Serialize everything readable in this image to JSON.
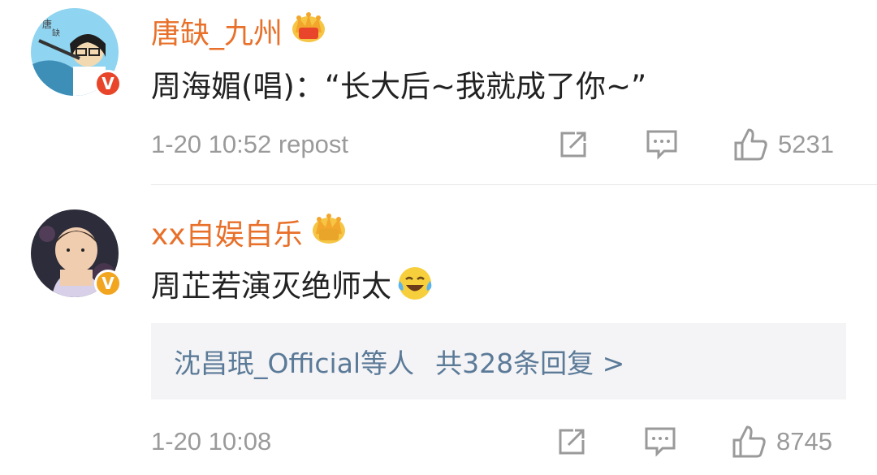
{
  "comments": [
    {
      "username": "唐缺_九州",
      "text": "周海媚(唱)：“长大后~我就成了你~”",
      "timestamp": "1-20 10:52 repost",
      "like_count": "5231",
      "badge": "V",
      "badge_color": "#e8452a"
    },
    {
      "username": "xx自娱自乐",
      "text": "周芷若演灭绝师太",
      "timestamp": "1-20 10:08",
      "like_count": "8745",
      "badge": "V",
      "badge_color": "#f2a51f",
      "replies": {
        "users": "沈昌珉_Official等人",
        "summary": "共328条回复 >"
      }
    }
  ],
  "colors": {
    "username": "#e8702a",
    "meta": "#9a9a9a",
    "reply_link": "#5b7a98",
    "reply_bg": "#f4f4f6"
  },
  "icons": [
    "crown-icon",
    "verified-badge-icon",
    "repost-icon",
    "comment-icon",
    "like-icon",
    "laughing-tears-emoji-icon"
  ]
}
